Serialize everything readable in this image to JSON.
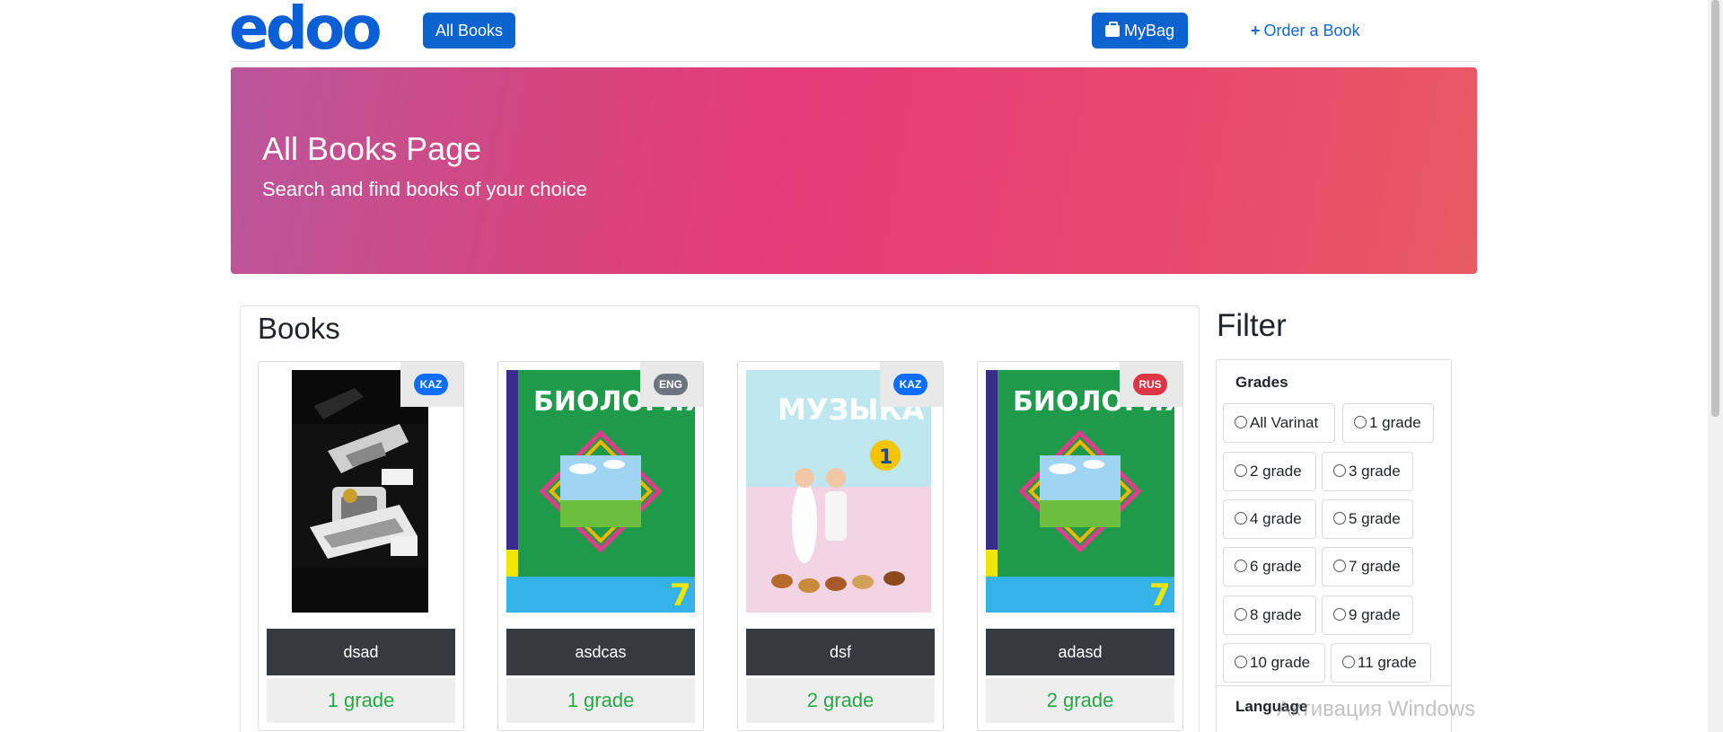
{
  "navbar": {
    "logo": "edoo",
    "all_books": "All Books",
    "my_bag": "MyBag",
    "order_plus": "+",
    "order_book": "Order a Book"
  },
  "hero": {
    "title": "All Books Page",
    "subtitle": "Search and find books of your choice"
  },
  "books": {
    "title": "Books",
    "items": [
      {
        "name": "dsad",
        "grade": "1 grade",
        "lang": "KAZ",
        "lang_color": "#0d6efd"
      },
      {
        "name": "asdcas",
        "grade": "1 grade",
        "lang": "ENG",
        "lang_color": "#6c757d"
      },
      {
        "name": "dsf",
        "grade": "2 grade",
        "lang": "KAZ",
        "lang_color": "#0d6efd"
      },
      {
        "name": "adasd",
        "grade": "2 grade",
        "lang": "RUS",
        "lang_color": "#dc3545"
      }
    ]
  },
  "filter": {
    "title": "Filter",
    "grades_label": "Grades",
    "grades": [
      "All Varinat",
      "1 grade",
      "2 grade",
      "3 grade",
      "4 grade",
      "5 grade",
      "6 grade",
      "7 grade",
      "8 grade",
      "9 grade",
      "10 grade",
      "11 grade"
    ],
    "language_label": "Language"
  },
  "watermark": "Активация Windows",
  "colors": {
    "primary": "#0b63d0",
    "success": "#28a745",
    "dark": "#343a40"
  }
}
